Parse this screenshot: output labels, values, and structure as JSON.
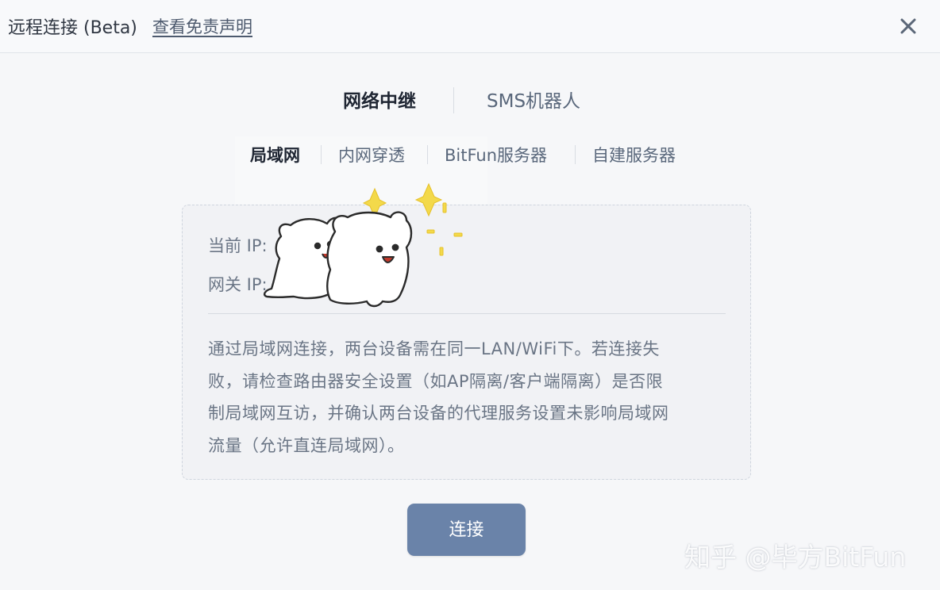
{
  "header": {
    "title": "远程连接 (Beta)",
    "disclaimer_link": "查看免责声明",
    "close_icon": "close-icon"
  },
  "main_tabs": [
    {
      "label": "网络中继",
      "active": true
    },
    {
      "label": "SMS机器人",
      "active": false
    }
  ],
  "sub_tabs": [
    {
      "label": "局域网",
      "active": true
    },
    {
      "label": "内网穿透",
      "active": false
    },
    {
      "label": "BitFun服务器",
      "active": false
    },
    {
      "label": "自建服务器",
      "active": false
    }
  ],
  "panel": {
    "current_ip_label": "当前 IP:",
    "gateway_ip_label": "网关 IP:",
    "description_lines": [
      "通过局域网连接，两台设备需在同一LAN/WiFi下。若连接失",
      "败，请检查路由器安全设置（如AP隔离/客户端隔离）是否限",
      "制局域网互访，并确认两台设备的代理服务设置未影响局域网",
      "流量（允许直连局域网）。"
    ]
  },
  "connect_button": "连接",
  "watermark": "知乎 @毕方BitFun",
  "colors": {
    "accent_button": "#6a83a9",
    "background": "#f6f7f9",
    "panel_background": "#f1f2f5",
    "sparkle": "#f3d94a"
  }
}
